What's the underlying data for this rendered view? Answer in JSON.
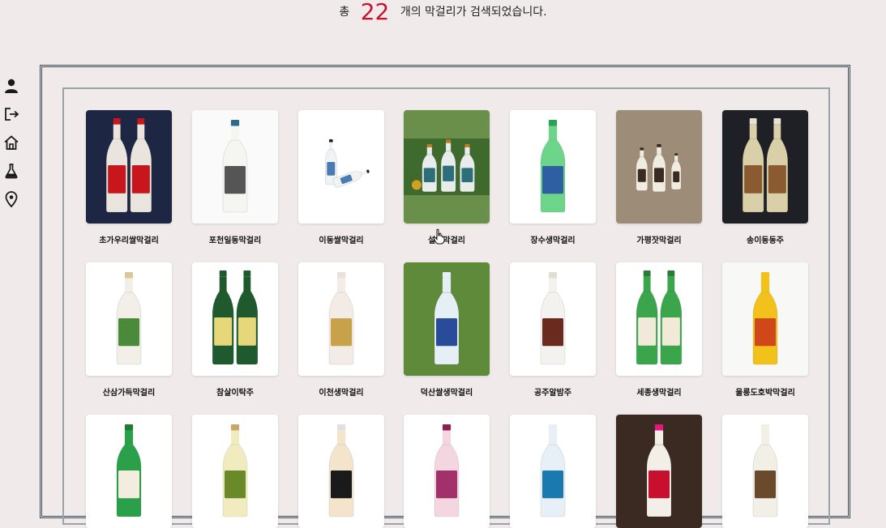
{
  "result_summary": {
    "prefix": "총",
    "count": "22",
    "suffix": "개의 막걸리가 검색되었습니다."
  },
  "side_nav": [
    {
      "name": "user-icon"
    },
    {
      "name": "logout-icon"
    },
    {
      "name": "home-icon"
    },
    {
      "name": "flask-icon"
    },
    {
      "name": "location-pin-icon"
    }
  ],
  "colors": {
    "accent": "#c8102e",
    "background": "#f0ebea",
    "frame": "#3a4a55"
  },
  "products": [
    {
      "name": "초가우리쌀막걸리",
      "bg": "#1d2744",
      "bottle": "#e9e4dd",
      "label": "#c8161d",
      "cap": "#c8161d",
      "shape": "pair"
    },
    {
      "name": "포천일동막걸리",
      "bg": "#fafafa",
      "bottle": "#f5f5f2",
      "label": "#555555",
      "cap": "#2d6a8a",
      "shape": "single"
    },
    {
      "name": "이동쌀막걸리",
      "bg": "#ffffff",
      "bottle": "#f1f2f4",
      "label": "#4a7bb5",
      "cap": "#222222",
      "shape": "lying"
    },
    {
      "name": "설악막걸리",
      "bg": "#6a8f4a",
      "bottle": "#e8ecea",
      "label": "#2c6e7a",
      "cap": "#c87a20",
      "shape": "trio"
    },
    {
      "name": "장수생막걸리",
      "bg": "#ffffff",
      "bottle": "#6dd58a",
      "label": "#2f5fa3",
      "cap": "#2aa052",
      "shape": "single"
    },
    {
      "name": "가평잣막걸리",
      "bg": "#9c8c78",
      "bottle": "#f1ece0",
      "label": "#3a2a22",
      "cap": "#3a2a22",
      "shape": "group"
    },
    {
      "name": "송이동동주",
      "bg": "#1f1f26",
      "bottle": "#d9cfa8",
      "label": "#8a5a30",
      "cap": "#e8e2d0",
      "shape": "pair"
    },
    {
      "name": "산삼가득막걸리",
      "bg": "#ffffff",
      "bottle": "#f1efe8",
      "label": "#4a8a3a",
      "cap": "#d8c89a",
      "shape": "single"
    },
    {
      "name": "참살이탁주",
      "bg": "#ffffff",
      "bottle": "#1f5a2e",
      "label": "#e6d87a",
      "cap": "#1f5a2e",
      "shape": "pair"
    },
    {
      "name": "이천생막걸리",
      "bg": "#ffffff",
      "bottle": "#f3ece6",
      "label": "#c8a24a",
      "cap": "#e8e2dc",
      "shape": "single"
    },
    {
      "name": "덕산쌀생막걸리",
      "bg": "#5f8a3a",
      "bottle": "#e6eef6",
      "label": "#2a4a9a",
      "cap": "#e6eef6",
      "shape": "single"
    },
    {
      "name": "공주알밤주",
      "bg": "#ffffff",
      "bottle": "#f4f2ee",
      "label": "#6a2a1e",
      "cap": "#e0ddd6",
      "shape": "single"
    },
    {
      "name": "세종생막걸리",
      "bg": "#ffffff",
      "bottle": "#3aa54a",
      "label": "#f1ead8",
      "cap": "#2a7a3a",
      "shape": "pair"
    },
    {
      "name": "울릉도호박막걸리",
      "bg": "#f8f8f6",
      "bottle": "#f2c21a",
      "label": "#d0481a",
      "cap": "#f2c21a",
      "shape": "single"
    },
    {
      "name": "",
      "bg": "#ffffff",
      "bottle": "#2aa04a",
      "label": "#f3ede0",
      "cap": "#1f7a36",
      "shape": "single"
    },
    {
      "name": "",
      "bg": "#ffffff",
      "bottle": "#f1ecc0",
      "label": "#6a8a2a",
      "cap": "#c8a86a",
      "shape": "single"
    },
    {
      "name": "",
      "bg": "#ffffff",
      "bottle": "#f4e4cc",
      "label": "#1a1a1a",
      "cap": "#e0e0e0",
      "shape": "single"
    },
    {
      "name": "",
      "bg": "#ffffff",
      "bottle": "#f4d6e0",
      "label": "#a2306a",
      "cap": "#8a2050",
      "shape": "single"
    },
    {
      "name": "",
      "bg": "#ffffff",
      "bottle": "#e6f0f6",
      "label": "#1a7ab0",
      "cap": "#e6f0f6",
      "shape": "single"
    },
    {
      "name": "",
      "bg": "#3a2a22",
      "bottle": "#f3eee8",
      "label": "#c8102e",
      "cap": "#e4177a",
      "shape": "single"
    },
    {
      "name": "",
      "bg": "#ffffff",
      "bottle": "#f2efe6",
      "label": "#6a4a2a",
      "cap": "#f2efe6",
      "shape": "single"
    }
  ]
}
